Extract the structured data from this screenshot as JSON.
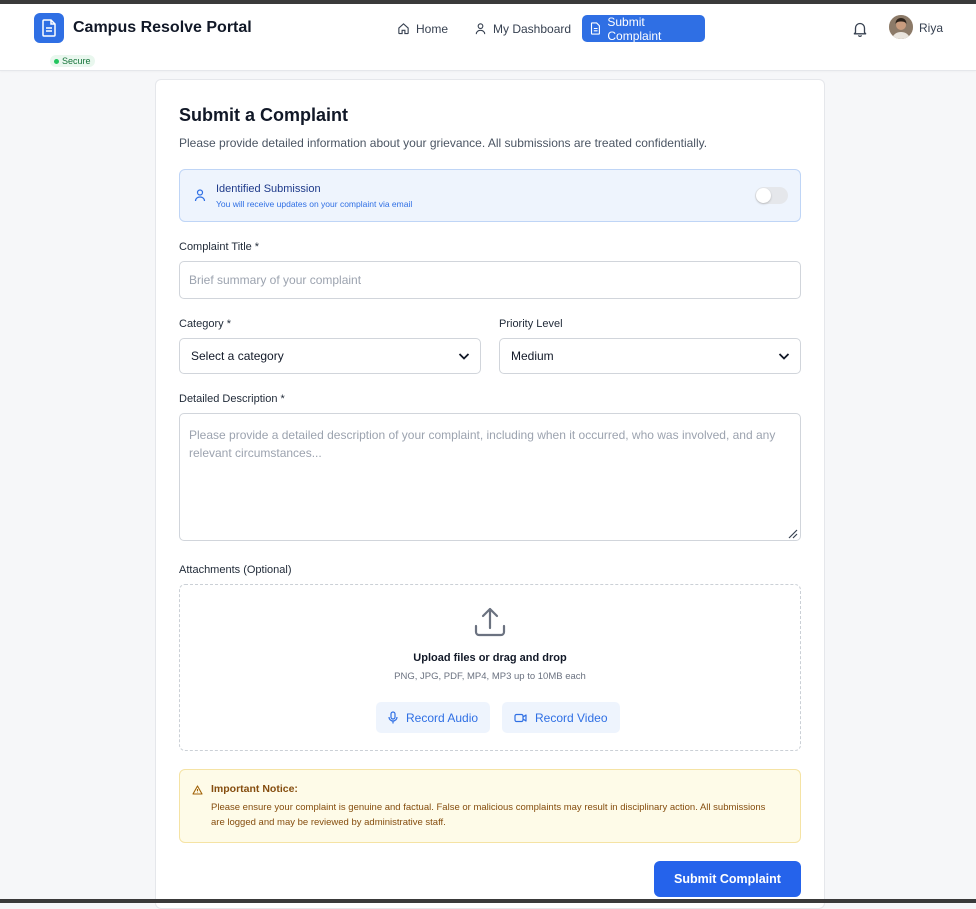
{
  "header": {
    "brand": "Campus Resolve Portal",
    "secure_badge": "Secure",
    "nav": [
      {
        "label": "Home",
        "icon": "home-icon"
      },
      {
        "label": "My Dashboard",
        "icon": "user-icon"
      },
      {
        "label": "Submit Complaint",
        "icon": "document-icon",
        "active": true
      }
    ],
    "user_name": "Riya"
  },
  "form": {
    "title": "Submit a Complaint",
    "subtitle": "Please provide detailed information about your grievance. All submissions are treated confidentially.",
    "identified": {
      "title": "Identified Submission",
      "subtitle": "You will receive updates on your complaint via email",
      "enabled": false
    },
    "complaint_title_label": "Complaint Title *",
    "complaint_title_placeholder": "Brief summary of your complaint",
    "category_label": "Category *",
    "category_value": "Select a category",
    "priority_label": "Priority Level",
    "priority_value": "Medium",
    "description_label": "Detailed Description *",
    "description_placeholder": "Please provide a detailed description of your complaint, including when it occurred, who was involved, and any relevant circumstances...",
    "attachments_label": "Attachments (Optional)",
    "upload_title": "Upload files or drag and drop",
    "upload_sub": "PNG, JPG, PDF, MP4, MP3 up to 10MB each",
    "record_audio": "Record Audio",
    "record_video": "Record Video",
    "notice_title": "Important Notice:",
    "notice_body": "Please ensure your complaint is genuine and factual. False or malicious complaints may result in disciplinary action. All submissions are logged and may be reviewed by administrative staff.",
    "submit": "Submit Complaint"
  },
  "colors": {
    "accent": "#2f6fe4",
    "submit": "#2563eb",
    "notice_bg": "#fefbe8",
    "notice_text": "#854d0e"
  }
}
